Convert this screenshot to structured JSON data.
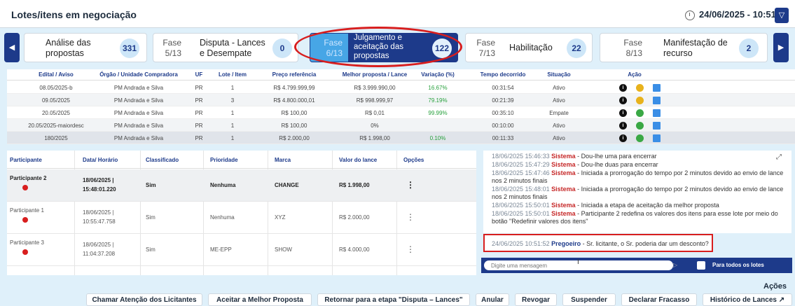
{
  "header": {
    "title": "Lotes/itens em negociação",
    "datetime": "24/06/2025 - 10:51:53",
    "filter_icon": "filter-icon"
  },
  "phases": [
    {
      "fase": "",
      "name": "Análise das propostas",
      "count": "331"
    },
    {
      "fase": "Fase 5/13",
      "name": "Disputa - Lances e Desempate",
      "count": "0"
    },
    {
      "fase": "Fase 6/13",
      "name": "Julgamento e aceitação das propostas",
      "count": "122"
    },
    {
      "fase": "Fase 7/13",
      "name": "Habilitação",
      "count": "22"
    },
    {
      "fase": "Fase 8/13",
      "name": "Manifestação de recurso",
      "count": "2"
    }
  ],
  "lots_table": {
    "headers": [
      "Edital / Aviso",
      "Órgão / Unidade Compradora",
      "UF",
      "Lote / Item",
      "Preço referência",
      "Melhor proposta / Lance",
      "Variação (%)",
      "Tempo decorrido",
      "Situação",
      "Ação"
    ],
    "rows": [
      [
        "08.05/2025-b",
        "PM Andrada e Silva",
        "PR",
        "1",
        "R$ 4.799.999,99",
        "R$ 3.999.990,00",
        "16.67%",
        "00:31:54",
        "Ativo"
      ],
      [
        "09.05/2025",
        "PM Andrada e Silva",
        "PR",
        "3",
        "R$ 4.800.000,01",
        "R$ 998.999,97",
        "79.19%",
        "00:21:39",
        "Ativo"
      ],
      [
        "20.05/2025",
        "PM Andrada e Silva",
        "PR",
        "1",
        "R$ 100,00",
        "R$ 0,01",
        "99.99%",
        "00:35:10",
        "Empate"
      ],
      [
        "20.05/2025-maiordesc",
        "PM Andrada e Silva",
        "PR",
        "1",
        "R$ 100,00",
        "0%",
        "",
        "00:10:00",
        "Ativo"
      ],
      [
        "180/2025",
        "PM Andrada e Silva",
        "PR",
        "1",
        "R$ 2.000,00",
        "R$ 1.998,00",
        "0.10%",
        "00:11:33",
        "Ativo"
      ]
    ],
    "action_colors": [
      "#e8b21c",
      "#e8b21c",
      "#3aa845",
      "#3aa845",
      "#3aa845"
    ]
  },
  "bids_table": {
    "headers": [
      "Participante",
      "Data/ Horário",
      "Classificado",
      "Prioridade",
      "Marca",
      "Valor do lance",
      "Opções"
    ],
    "rows": [
      {
        "participante": "Participante 2",
        "data": "18/06/2025 |",
        "hora": "15:48:01.220",
        "classificado": "Sim",
        "prioridade": "Nenhuma",
        "marca": "CHANGE",
        "valor": "R$ 1.998,00",
        "opcoes": "⋮"
      },
      {
        "participante": "Participante 1",
        "data": "18/06/2025 |",
        "hora": "10:55:47.758",
        "classificado": "Sim",
        "prioridade": "Nenhuma",
        "marca": "XYZ",
        "valor": "R$ 2.000,00",
        "opcoes": "⋮"
      },
      {
        "participante": "Participante 3",
        "data": "18/06/2025 |",
        "hora": "11:04:37.208",
        "classificado": "Sim",
        "prioridade": "ME-EPP",
        "marca": "SHOW",
        "valor": "R$ 4.000,00",
        "opcoes": "⋮"
      }
    ]
  },
  "chat": {
    "messages": [
      {
        "ts": "18/06/2025 15:46:33",
        "who": "Sistema",
        "text": " - Dou-lhe uma para encerrar"
      },
      {
        "ts": "18/06/2025 15:47:29",
        "who": "Sistema",
        "text": " - Dou-lhe duas para encerrar"
      },
      {
        "ts": "18/06/2025 15:47:46",
        "who": "Sistema",
        "text": " - Iniciada a prorrogação do tempo por 2 minutos devido ao envio de lance nos 2 minutos finais"
      },
      {
        "ts": "18/06/2025 15:48:01",
        "who": "Sistema",
        "text": " - Iniciada a prorrogação do tempo por 2 minutos devido ao envio de lance nos 2 minutos finais"
      },
      {
        "ts": "18/06/2025 15:50:01",
        "who": "Sistema",
        "text": " - Iniciada a etapa de aceitação da melhor proposta"
      },
      {
        "ts": "18/06/2025 15:50:01",
        "who": "Sistema",
        "text": " - Participante 2 redefina os valores dos itens para esse lote por meio do botão \"Redefinir valores dos itens\""
      }
    ],
    "pregoeiro": {
      "ts": "24/06/2025 10:51:52",
      "who": "Pregoeiro",
      "text": " - Sr. licitante, o Sr. poderia dar um desconto?"
    },
    "input_placeholder": "Digite uma mensagem",
    "all_lots_label": "Para todos os lotes"
  },
  "actions": {
    "title": "Ações",
    "buttons": [
      "Chamar Atenção dos Licitantes",
      "Aceitar a Melhor Proposta",
      "Retornar para a etapa \"Disputa – Lances\"",
      "Anular",
      "Revogar",
      "Suspender",
      "Declarar Fracasso",
      "Histórico de Lances ↗"
    ]
  }
}
